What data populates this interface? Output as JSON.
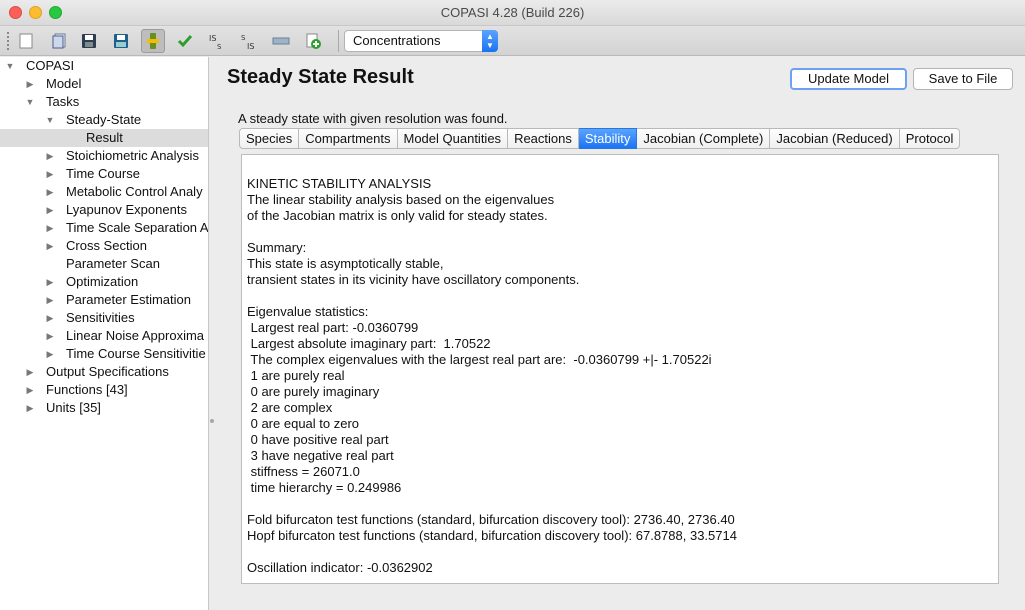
{
  "window": {
    "title": "COPASI 4.28 (Build 226)"
  },
  "toolbar": {
    "buttons": [
      "new-file-icon",
      "open-file-icon",
      "save-icon",
      "save-as-icon",
      "run-icon",
      "check-icon",
      "slider-is-icon",
      "slider-sis-icon",
      "bar-icon",
      "add-icon"
    ],
    "mode_select": "Concentrations"
  },
  "tree": {
    "items": [
      {
        "label": "COPASI"
      },
      {
        "label": "Model"
      },
      {
        "label": "Tasks"
      },
      {
        "label": "Steady-State"
      },
      {
        "label": "Result"
      },
      {
        "label": "Stoichiometric Analysis"
      },
      {
        "label": "Time Course"
      },
      {
        "label": "Metabolic Control Analy"
      },
      {
        "label": "Lyapunov Exponents"
      },
      {
        "label": "Time Scale Separation A"
      },
      {
        "label": "Cross Section"
      },
      {
        "label": "Parameter Scan"
      },
      {
        "label": "Optimization"
      },
      {
        "label": "Parameter Estimation"
      },
      {
        "label": "Sensitivities"
      },
      {
        "label": "Linear Noise Approxima"
      },
      {
        "label": "Time Course Sensitivitie"
      },
      {
        "label": "Output Specifications"
      },
      {
        "label": "Functions [43]"
      },
      {
        "label": "Units [35]"
      }
    ]
  },
  "main": {
    "title": "Steady State Result",
    "update_button": "Update Model",
    "save_button": "Save to File",
    "status_message": "A steady state with given resolution was found.",
    "tabs": [
      "Species",
      "Compartments",
      "Model Quantities",
      "Reactions",
      "Stability",
      "Jacobian (Complete)",
      "Jacobian (Reduced)",
      "Protocol"
    ],
    "active_tab": "Stability",
    "report_lines": [
      "KINETIC STABILITY ANALYSIS",
      "The linear stability analysis based on the eigenvalues",
      "of the Jacobian matrix is only valid for steady states.",
      "",
      "Summary:",
      "This state is asymptotically stable,",
      "transient states in its vicinity have oscillatory components.",
      "",
      "Eigenvalue statistics:",
      " Largest real part: -0.0360799",
      " Largest absolute imaginary part:  1.70522",
      " The complex eigenvalues with the largest real part are:  -0.0360799 +|- 1.70522i",
      " 1 are purely real",
      " 0 are purely imaginary",
      " 2 are complex",
      " 0 are equal to zero",
      " 0 have positive real part",
      " 3 have negative real part",
      " stiffness = 26071.0",
      " time hierarchy = 0.249986",
      "",
      "Fold bifurcaton test functions (standard, bifurcation discovery tool): 2736.40, 2736.40",
      "Hopf bifurcaton test functions (standard, bifurcation discovery tool): 67.8788, 33.5714",
      "",
      "Oscillation indicator: -0.0362902"
    ]
  },
  "colors": {
    "accent": "#1c74f3",
    "selection": "#dcdcdc"
  }
}
